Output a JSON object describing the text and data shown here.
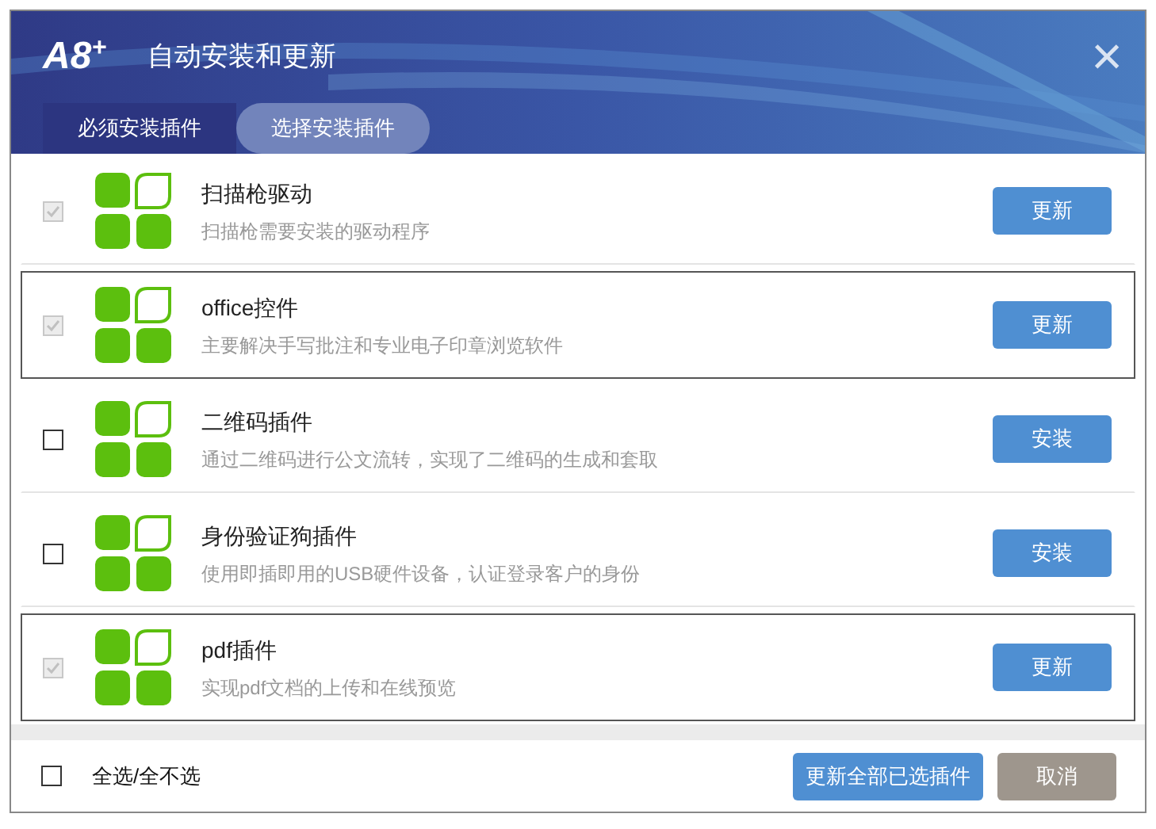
{
  "window": {
    "logo": "A8",
    "logo_mark": "+",
    "title": "自动安装和更新",
    "close": "×"
  },
  "tabs": [
    {
      "label": "必须安装插件",
      "selected": false
    },
    {
      "label": "选择安装插件",
      "selected": true
    }
  ],
  "plugins": [
    {
      "name": "扫描枪驱动",
      "description": "扫描枪需要安装的驱动程序",
      "checked": true,
      "disabled": true,
      "highlighted": false,
      "action": "更新"
    },
    {
      "name": "office控件",
      "description": "主要解决手写批注和专业电子印章浏览软件",
      "checked": true,
      "disabled": true,
      "highlighted": true,
      "action": "更新"
    },
    {
      "name": "二维码插件",
      "description": "通过二维码进行公文流转，实现了二维码的生成和套取",
      "checked": false,
      "disabled": false,
      "highlighted": false,
      "action": "安装"
    },
    {
      "name": "身份验证狗插件",
      "description": "使用即插即用的USB硬件设备，认证登录客户的身份",
      "checked": false,
      "disabled": false,
      "highlighted": false,
      "action": "安装"
    },
    {
      "name": "pdf插件",
      "description": "实现pdf文档的上传和在线预览",
      "checked": true,
      "disabled": true,
      "highlighted": true,
      "action": "更新"
    }
  ],
  "footer": {
    "select_all": {
      "label": "全选/全不选",
      "checked": false
    },
    "update_all": "更新全部已选插件",
    "cancel": "取消"
  }
}
